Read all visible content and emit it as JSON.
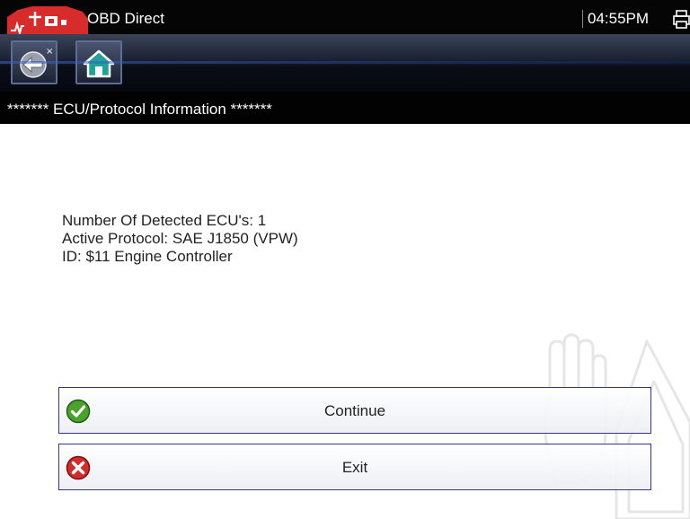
{
  "app": {
    "title": "OBD Direct",
    "logo_icon": "diagnostic-app-logo",
    "time": "04:55PM",
    "printer_icon": "printer-icon"
  },
  "toolbar": {
    "back_icon": "back-arrow-icon",
    "home_icon": "home-icon"
  },
  "section": {
    "title": "******* ECU/Protocol Information *******"
  },
  "info": {
    "lines": [
      "Number Of Detected ECU's: 1",
      "Active Protocol: SAE J1850 (VPW)",
      "ID: $11 Engine Controller"
    ]
  },
  "actions": [
    {
      "label": "Continue",
      "icon": "green-check-icon"
    },
    {
      "label": "Exit",
      "icon": "red-x-icon"
    }
  ],
  "colors": {
    "header_bg": "#050505",
    "button_border": "#3b3385",
    "continue_icon": "#4aa12b",
    "exit_icon": "#d52b2b"
  }
}
